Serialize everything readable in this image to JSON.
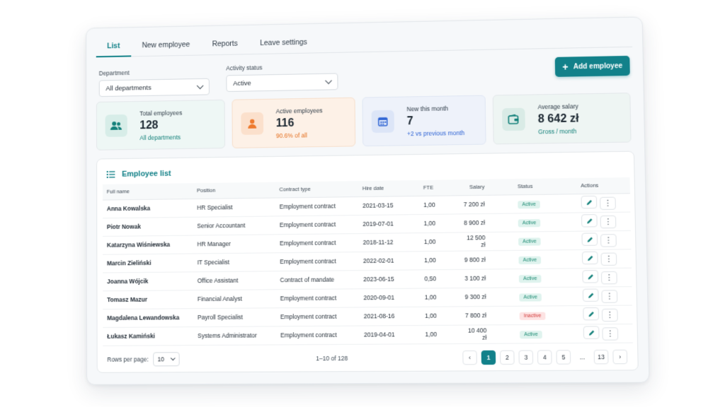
{
  "tabs": [
    {
      "label": "List",
      "active": true
    },
    {
      "label": "New employee",
      "active": false
    },
    {
      "label": "Reports",
      "active": false
    },
    {
      "label": "Leave settings",
      "active": false
    }
  ],
  "filters": {
    "department": {
      "label": "Department",
      "value": "All departments"
    },
    "activity": {
      "label": "Activity status",
      "value": "Active"
    }
  },
  "add_button": {
    "label": "Add employee",
    "icon": "plus-icon"
  },
  "cards": [
    {
      "label": "Total employees",
      "value": "128",
      "sub": "All departments",
      "icon": "users-icon",
      "bg": "#eef7f5",
      "icon_bg": "#d7ede8",
      "icon_color": "#13807a",
      "sub_color": "#13807a"
    },
    {
      "label": "Active employees",
      "value": "116",
      "sub": "90.6% of all",
      "icon": "user-icon",
      "bg": "#fdf1e7",
      "icon_bg": "#fbe0cc",
      "icon_color": "#ee7a2e",
      "sub_color": "#e46f1f"
    },
    {
      "label": "New this month",
      "value": "7",
      "sub": "+2 vs previous month",
      "icon": "calendar-icon",
      "bg": "#eef2fa",
      "icon_bg": "#dce5f7",
      "icon_color": "#2f64d4",
      "sub_color": "#2f64d4"
    },
    {
      "label": "Average salary",
      "value": "8 642 zł",
      "sub": "Gross / month",
      "icon": "wallet-icon",
      "bg": "#eef5f3",
      "icon_bg": "#d9ebe6",
      "icon_color": "#13807a",
      "sub_color": "#13807a"
    }
  ],
  "table": {
    "title": "Employee list",
    "columns": [
      "Full name",
      "Position",
      "Contract type",
      "Hire date",
      "FTE",
      "Salary",
      "Status",
      "Actions"
    ],
    "rows": [
      {
        "name": "Anna Kowalska",
        "position": "HR Specialist",
        "contract": "Employment contract",
        "hire": "2021-03-15",
        "fte": "1,00",
        "salary": "7 200 zł",
        "status": "Active"
      },
      {
        "name": "Piotr Nowak",
        "position": "Senior Accountant",
        "contract": "Employment contract",
        "hire": "2019-07-01",
        "fte": "1,00",
        "salary": "8 900 zł",
        "status": "Active"
      },
      {
        "name": "Katarzyna Wiśniewska",
        "position": "HR Manager",
        "contract": "Employment contract",
        "hire": "2018-11-12",
        "fte": "1,00",
        "salary": "12 500 zł",
        "status": "Active"
      },
      {
        "name": "Marcin Zieliński",
        "position": "IT Specialist",
        "contract": "Employment contract",
        "hire": "2022-02-01",
        "fte": "1,00",
        "salary": "9 800 zł",
        "status": "Active"
      },
      {
        "name": "Joanna Wójcik",
        "position": "Office Assistant",
        "contract": "Contract of mandate",
        "hire": "2023-06-15",
        "fte": "0,50",
        "salary": "3 100 zł",
        "status": "Active"
      },
      {
        "name": "Tomasz Mazur",
        "position": "Financial Analyst",
        "contract": "Employment contract",
        "hire": "2020-09-01",
        "fte": "1,00",
        "salary": "9 300 zł",
        "status": "Active"
      },
      {
        "name": "Magdalena Lewandowska",
        "position": "Payroll Specialist",
        "contract": "Employment contract",
        "hire": "2021-08-16",
        "fte": "1,00",
        "salary": "7 800 zł",
        "status": "Inactive"
      },
      {
        "name": "Łukasz Kamiński",
        "position": "Systems Administrator",
        "contract": "Employment contract",
        "hire": "2019-04-01",
        "fte": "1,00",
        "salary": "10 400 zł",
        "status": "Active"
      }
    ]
  },
  "footer": {
    "rows_per_page_label": "Rows per page:",
    "rows_per_page": "10",
    "range": "1–10 of 128",
    "pages": [
      "1",
      "2",
      "3",
      "4",
      "5",
      "...",
      "13"
    ],
    "current_page": "1"
  }
}
